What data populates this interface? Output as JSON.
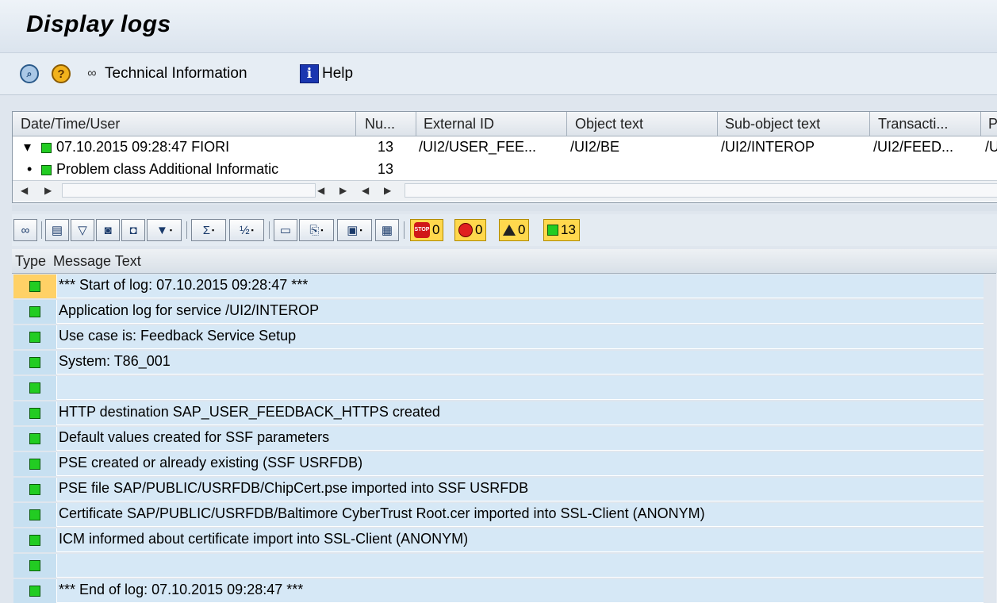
{
  "window": {
    "title": "Display logs"
  },
  "toolbar": {
    "technical_info_label": "Technical Information",
    "help_label": "Help",
    "icons": [
      "search-icon",
      "question-icon",
      "glasses-icon",
      "info-icon"
    ]
  },
  "tree": {
    "columns": [
      "Date/Time/User",
      "Nu...",
      "External ID",
      "Object text",
      "Sub-object text",
      "Transacti...",
      "P"
    ],
    "rows": [
      {
        "expander": "▾",
        "status": "green",
        "col0": "07.10.2015  09:28:47  FIORI",
        "col1": "13",
        "col2": "/UI2/USER_FEE...",
        "col3": "/UI2/BE",
        "col4": "/UI2/INTEROP",
        "col5": "/UI2/FEED...",
        "col6": "/U"
      },
      {
        "expander": "•",
        "status": "green",
        "col0": "Problem class Additional Informatic",
        "col1": "13",
        "col2": "",
        "col3": "",
        "col4": "",
        "col5": "",
        "col6": ""
      }
    ]
  },
  "message_toolbar": {
    "counts": {
      "stop": "0",
      "error": "0",
      "warning": "0",
      "success": "13"
    },
    "icons": [
      "glasses-icon",
      "print-icon",
      "filter-icon",
      "binoculars-icon",
      "find-next-icon",
      "set-filter-icon",
      "sum-icon",
      "subtotal-icon",
      "print-preview-icon",
      "export-icon",
      "spreadsheet-icon",
      "layout-icon"
    ]
  },
  "messages": {
    "headers": {
      "type": "Type",
      "text": "Message Text"
    },
    "rows": [
      "*** Start of log: 07.10.2015 09:28:47 ***",
      "Application log for service /UI2/INTEROP",
      "Use case is: Feedback Service Setup",
      "System: T86_001",
      "",
      "HTTP destination SAP_USER_FEEDBACK_HTTPS created",
      "Default values created for SSF parameters",
      "PSE created or already existing (SSF USRFDB)",
      "PSE file SAP/PUBLIC/USRFDB/ChipCert.pse imported into SSF USRFDB",
      "Certificate SAP/PUBLIC/USRFDB/Baltimore CyberTrust Root.cer imported into SSL-Client (ANONYM)",
      "ICM informed about certificate import into SSL-Client (ANONYM)",
      "",
      "*** End of log: 07.10.2015 09:28:47 ***"
    ]
  },
  "colors": {
    "success": "#22cc22",
    "stop": "#d01818",
    "counter_bg": "#ffd84d",
    "selected_type": "#ffd166"
  }
}
